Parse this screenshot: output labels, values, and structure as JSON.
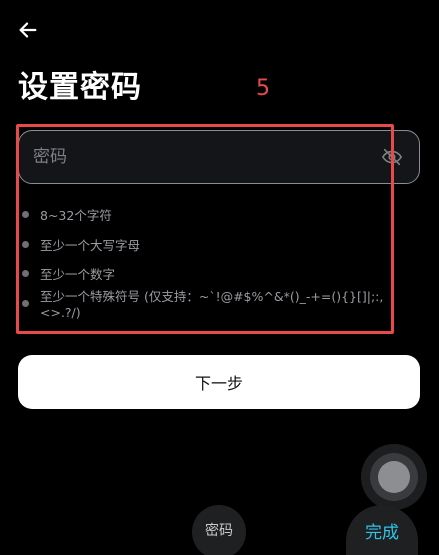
{
  "header": {
    "back_icon": "arrow-left-icon",
    "title": "设置密码"
  },
  "annotation": {
    "number": "5",
    "color": "#e84a4a"
  },
  "password_field": {
    "value": "",
    "placeholder": "密码",
    "toggle_icon": "eye-off-icon"
  },
  "rules": [
    "8~32个字符",
    "至少一个大写字母",
    "至少一个数字",
    "至少一个特殊符号 (仅支持：~`!@#$%^&*()_-+=(){}[]|;:,<>.?/)"
  ],
  "next_button": {
    "label": "下一步"
  },
  "keyboard": {
    "field_label": "密码",
    "done_label": "完成",
    "done_color": "#2ec4e8"
  },
  "assistive_touch": {
    "icon": "assistive-touch-icon"
  }
}
